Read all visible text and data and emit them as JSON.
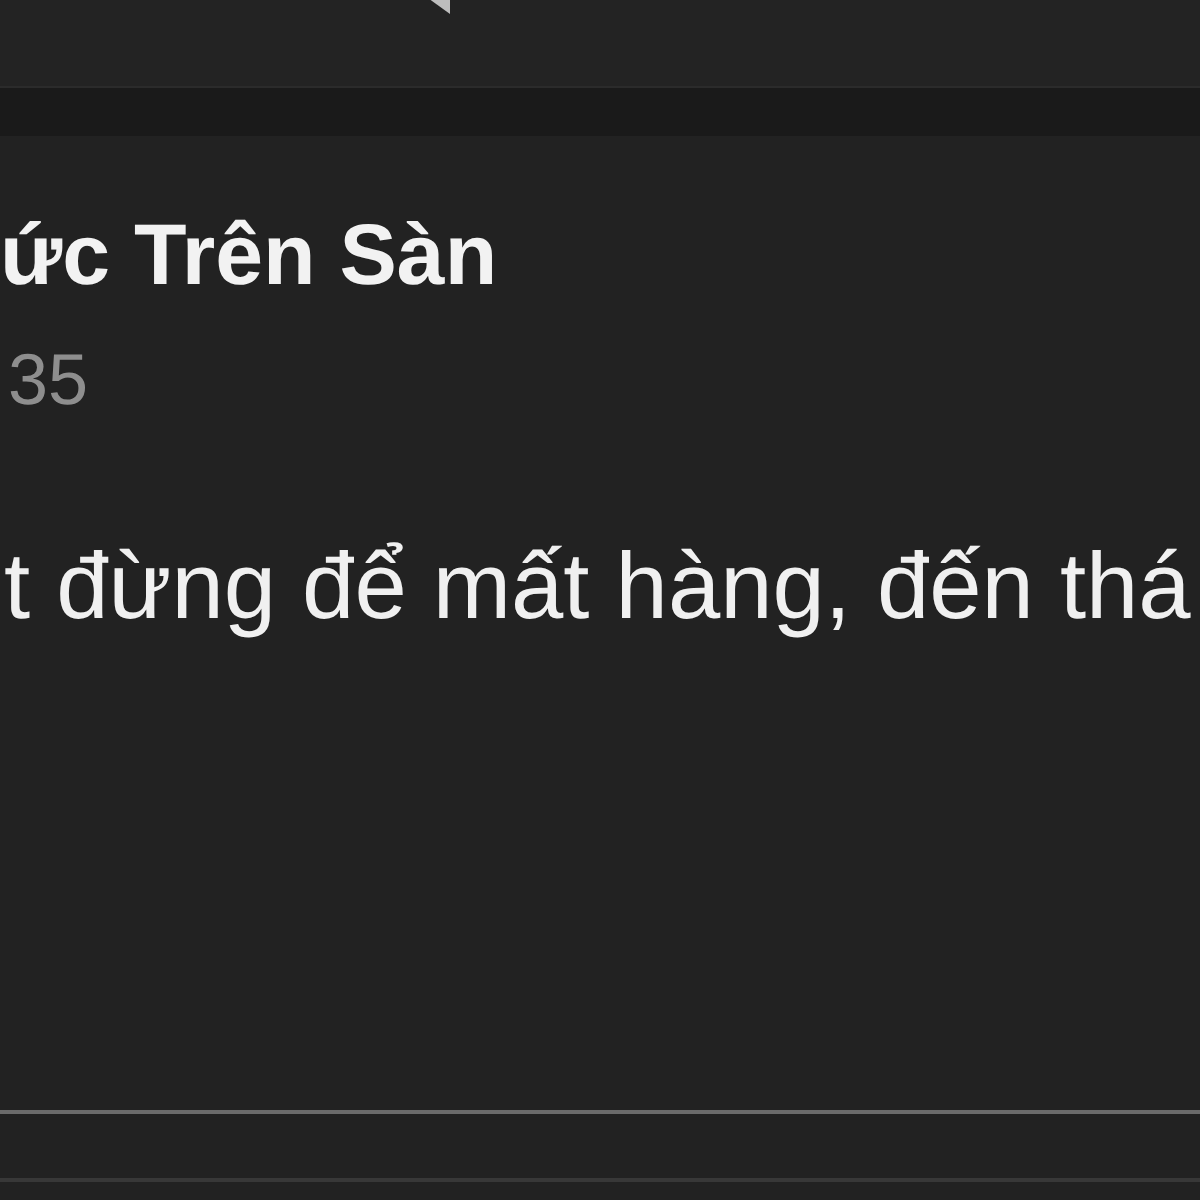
{
  "post": {
    "title": "ức Trên Sàn",
    "meta": "35",
    "body": "t đừng để mất hàng, đến thá"
  }
}
